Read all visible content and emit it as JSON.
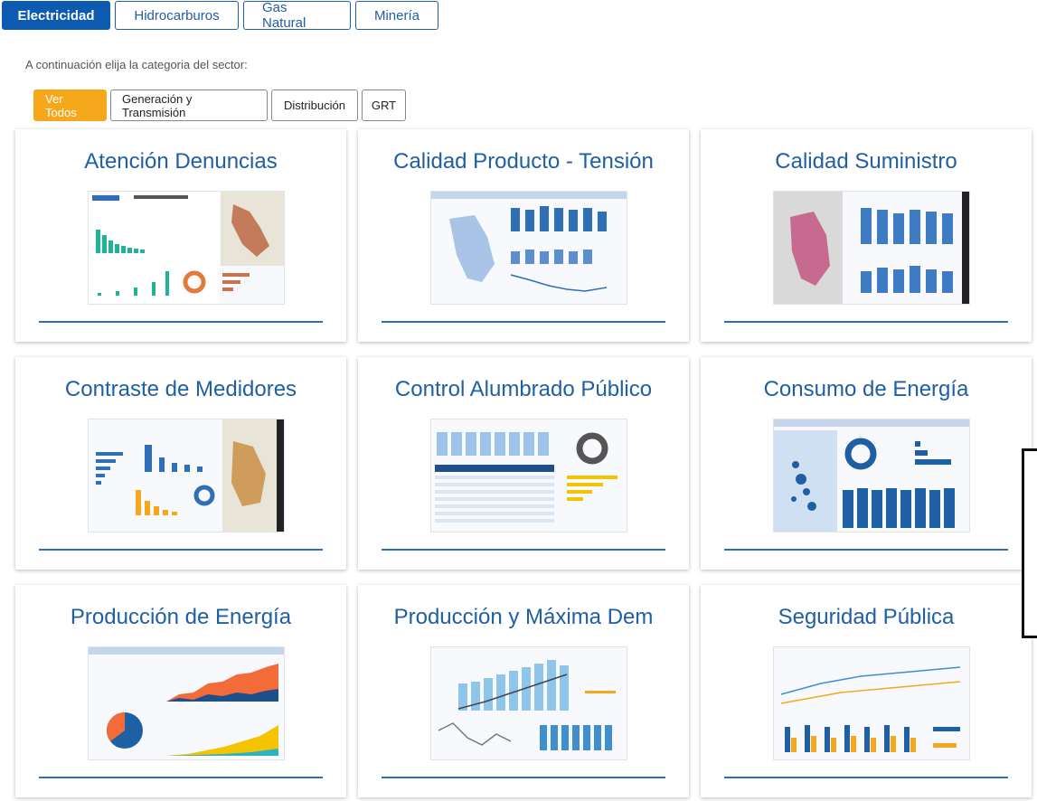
{
  "sector_tabs": [
    {
      "label": "Electricidad",
      "active": true
    },
    {
      "label": "Hidrocarburos",
      "active": false
    },
    {
      "label": "Gas Natural",
      "active": false
    },
    {
      "label": "Minería",
      "active": false
    }
  ],
  "category_prompt": "A continuación elija la categoria del sector:",
  "categories": [
    {
      "label": "Ver Todos",
      "active": true
    },
    {
      "label": "Generación y Transmisión",
      "active": false
    },
    {
      "label": "Distribución",
      "active": false
    },
    {
      "label": "GRT",
      "active": false
    }
  ],
  "colors": {
    "primary": "#0d5bb0",
    "accent": "#f5a81c",
    "title": "#1f5fa3"
  },
  "cards": [
    {
      "title": "Atención Denuncias"
    },
    {
      "title": "Calidad Producto - Tensión"
    },
    {
      "title": "Calidad Suministro"
    },
    {
      "title": "Contraste de Medidores"
    },
    {
      "title": "Control Alumbrado Público"
    },
    {
      "title": "Consumo de Energía"
    },
    {
      "title": "Producción de Energía"
    },
    {
      "title": "Producción y Máxima Dem"
    },
    {
      "title": "Seguridad Pública"
    }
  ]
}
